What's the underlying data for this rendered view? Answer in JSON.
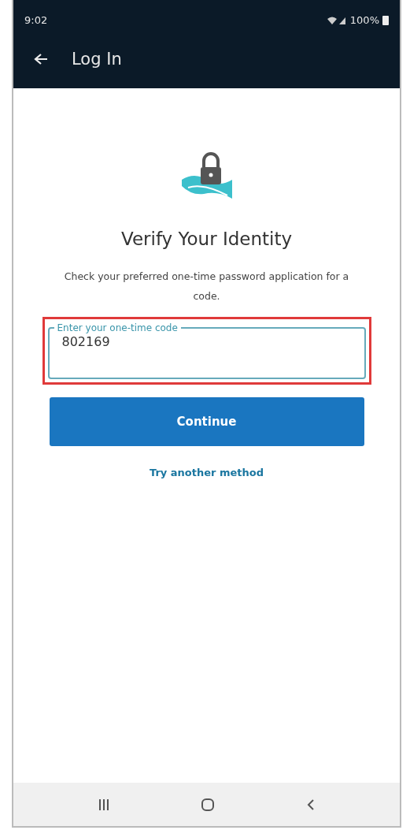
{
  "status_bar": {
    "time": "9:02",
    "battery": "100%"
  },
  "app_bar": {
    "title": "Log In"
  },
  "heading": "Verify Your Identity",
  "instructions": "Check your preferred one-time password application for a code.",
  "code_field": {
    "label": "Enter your one-time code",
    "value": "802169",
    "highlighted": true
  },
  "continue_button": "Continue",
  "alt_link": "Try another method"
}
